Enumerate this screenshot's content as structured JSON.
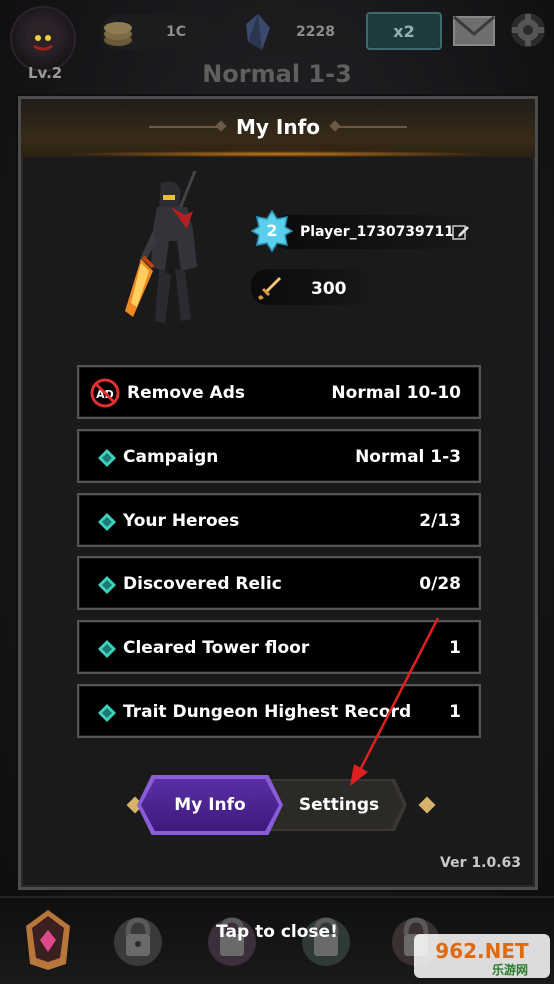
{
  "hud": {
    "level": "Lv.2",
    "coins": "1C",
    "gems": "2228",
    "multiplier": "x2",
    "stage": "Normal 1-3"
  },
  "panel": {
    "title": "My Info",
    "player_level": "2",
    "player_name": "Player_1730739711",
    "power": "300"
  },
  "stats": [
    {
      "label": "Remove Ads",
      "value": "Normal 10-10",
      "icon": "no-ads-icon"
    },
    {
      "label": "Campaign",
      "value": "Normal 1-3",
      "icon": "gem-bullet-icon"
    },
    {
      "label": "Your Heroes",
      "value": "2/13",
      "icon": "gem-bullet-icon"
    },
    {
      "label": "Discovered Relic",
      "value": "0/28",
      "icon": "gem-bullet-icon"
    },
    {
      "label": "Cleared Tower floor",
      "value": "1",
      "icon": "gem-bullet-icon"
    },
    {
      "label": "Trait Dungeon Highest Record",
      "value": "1",
      "icon": "gem-bullet-icon"
    }
  ],
  "tabs": {
    "my_info": "My Info",
    "settings": "Settings",
    "active": "my_info"
  },
  "version": "Ver 1.0.63",
  "footer": {
    "tap_to_close": "Tap to close!"
  },
  "watermark": {
    "brand": "962.NET",
    "sub": "乐游网"
  },
  "colors": {
    "accent_purple": "#5a2fa6",
    "bullet_teal": "#3fd0c0",
    "level_badge": "#4fc3e0",
    "arrow_red": "#e02020"
  }
}
